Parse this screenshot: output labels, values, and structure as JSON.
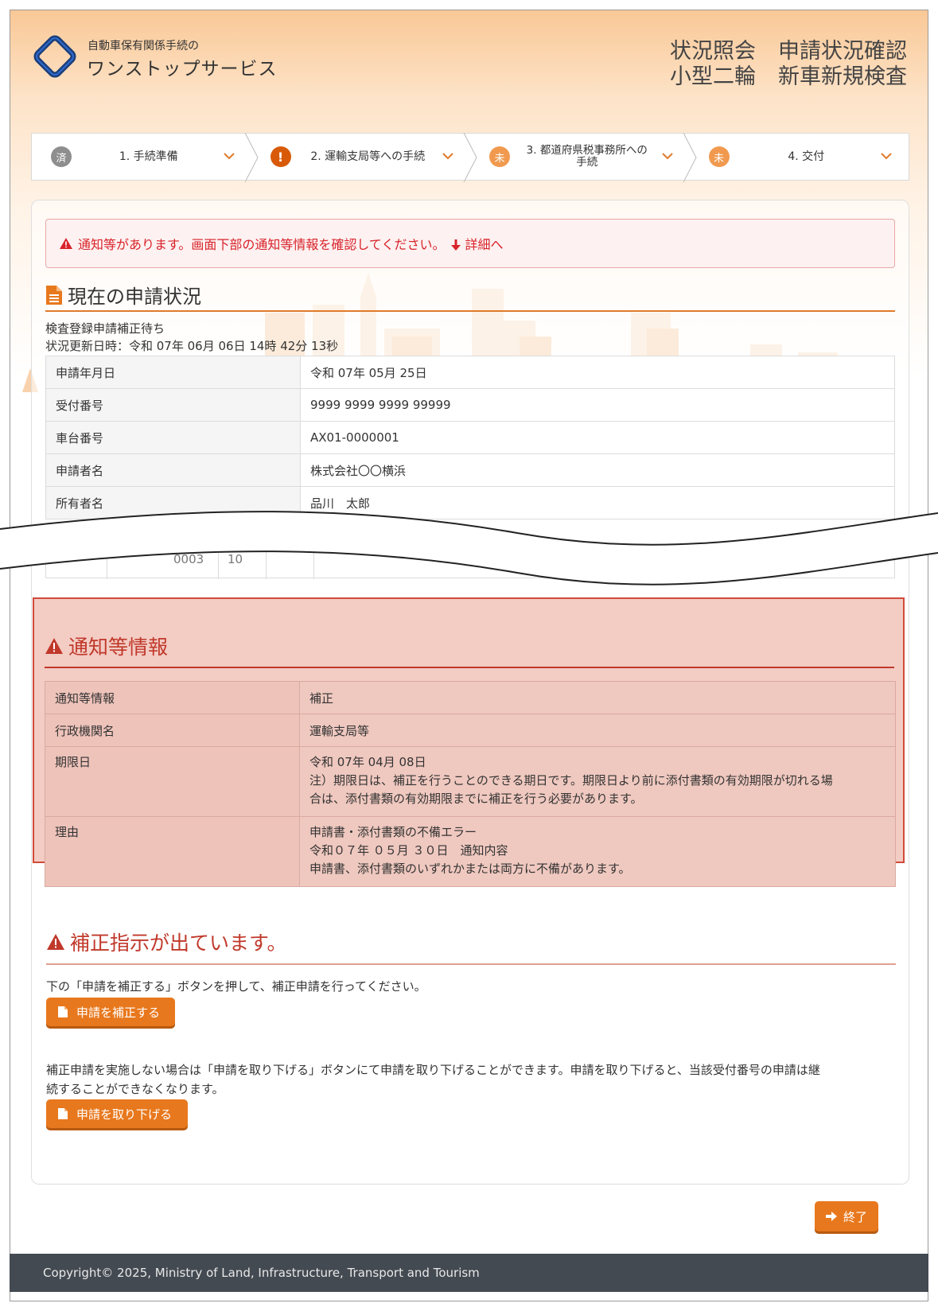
{
  "header": {
    "brand_sub": "自動車保有関係手続の",
    "brand_main": "ワンストップサービス",
    "title_line1a": "状況照会",
    "title_line1b": "申請状況確認",
    "title_line2a": "小型二輪",
    "title_line2b": "新車新規検査"
  },
  "steps": [
    {
      "badge": "済",
      "label": "1. 手続準備",
      "status": "done"
    },
    {
      "badge": "!",
      "label": "2. 運輸支局等への手続",
      "status": "warning"
    },
    {
      "badge": "未",
      "label": "3. 都道府県税事務所への手続",
      "status": "todo"
    },
    {
      "badge": "未",
      "label": "4. 交付",
      "status": "todo"
    }
  ],
  "alert": {
    "message": "通知等があります。画面下部の通知等情報を確認してください。",
    "link": "詳細へ"
  },
  "current_status": {
    "title": "現在の申請状況",
    "status_text": "検査登録申請補正待ち",
    "updated_at": "状況更新日時：令和 07年 06月 06日 14時 42分 13秒",
    "rows": [
      {
        "key": "申請年月日",
        "value": "令和 07年 05月 25日"
      },
      {
        "key": "受付番号",
        "value": "9999 9999 9999 99999"
      },
      {
        "key": "車台番号",
        "value": "AX01-0000001"
      },
      {
        "key": "申請者名",
        "value": "株式会社〇〇横浜"
      },
      {
        "key": "所有者名",
        "value": "品川　太郎"
      }
    ],
    "partial_cells": [
      "0003",
      "10"
    ]
  },
  "notice": {
    "title": "通知等情報",
    "rows": [
      {
        "key": "通知等情報",
        "lines": [
          "補正"
        ]
      },
      {
        "key": "行政機関名",
        "lines": [
          "運輸支局等"
        ]
      },
      {
        "key": "期限日",
        "lines": [
          "令和 07年 04月 08日",
          "注）期限日は、補正を行うことのできる期日です。期限日より前に添付書類の有効期限が切れる場",
          "合は、添付書類の有効期限までに補正を行う必要があります。"
        ]
      },
      {
        "key": "理由",
        "lines": [
          "申請書・添付書類の不備エラー",
          "令和０７年 ０５月 ３０日　通知内容",
          "申請書、添付書類のいずれかまたは両方に不備があります。"
        ]
      }
    ]
  },
  "correction": {
    "title": "補正指示が出ています。",
    "instruction": "下の「申請を補正する」ボタンを押して、補正申請を行ってください。",
    "correct_button": "申請を補正する",
    "withdraw_text_line1": "補正申請を実施しない場合は「申請を取り下げる」ボタンにて申請を取り下げることができます。申請を取り下げると、当該受付番号の申請は継",
    "withdraw_text_line2": "続することができなくなります。",
    "withdraw_button": "申請を取り下げる"
  },
  "end_button": "終了",
  "footer": {
    "copyright": "Copyright© 2025, Ministry of Land, Infrastructure, Transport and Tourism"
  },
  "colors": {
    "accent": "#e8781d",
    "alert_red": "#d8232a",
    "notice_bg": "#f3ccc4",
    "footer_bg": "#444a52"
  }
}
